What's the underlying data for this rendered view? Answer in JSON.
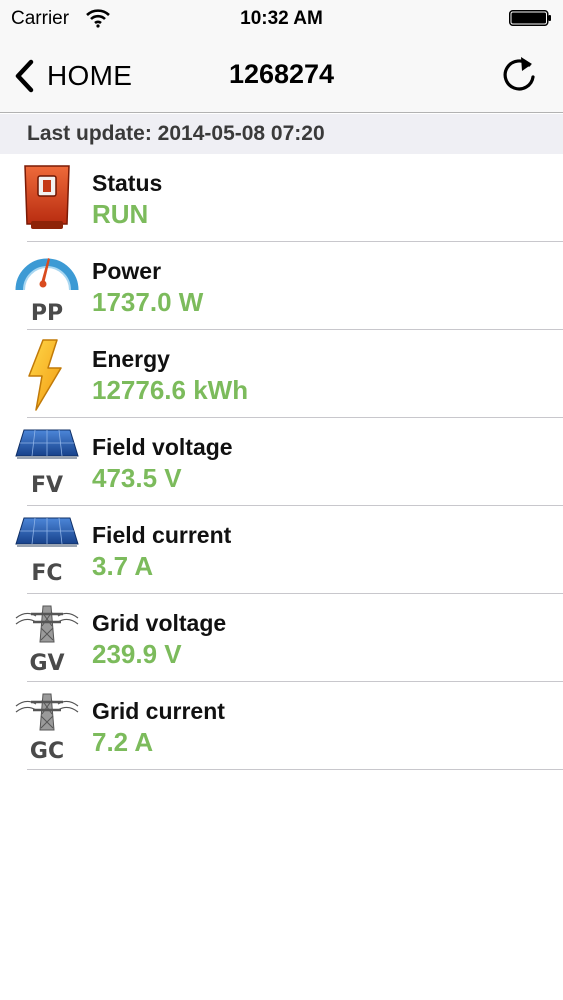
{
  "status_bar": {
    "carrier": "Carrier",
    "time": "10:32 AM",
    "wifi_icon": "wifi-icon",
    "battery_icon": "battery-icon"
  },
  "nav": {
    "back_label": "HOME",
    "title": "1268274",
    "refresh_icon": "refresh-icon"
  },
  "last_update": "Last update: 2014-05-08 07:20",
  "colors": {
    "value_green": "#7cbb5c",
    "separator": "#c8c7cc",
    "nav_background": "#f8f8f8",
    "update_background": "#efeff4"
  },
  "rows": [
    {
      "label": "Status",
      "value": "RUN",
      "icon": "status-icon"
    },
    {
      "label": "Power",
      "value": "1737.0 W",
      "icon": "power-gauge-icon",
      "icon_text": "PP"
    },
    {
      "label": "Energy",
      "value": "12776.6 kWh",
      "icon": "lightning-icon"
    },
    {
      "label": "Field voltage",
      "value": "473.5 V",
      "icon": "solar-panel-icon",
      "icon_text": "FV"
    },
    {
      "label": "Field current",
      "value": "3.7 A",
      "icon": "solar-panel-icon",
      "icon_text": "FC"
    },
    {
      "label": "Grid voltage",
      "value": "239.9 V",
      "icon": "power-pylon-icon",
      "icon_text": "GV"
    },
    {
      "label": "Grid current",
      "value": "7.2 A",
      "icon": "power-pylon-icon",
      "icon_text": "GC"
    }
  ]
}
